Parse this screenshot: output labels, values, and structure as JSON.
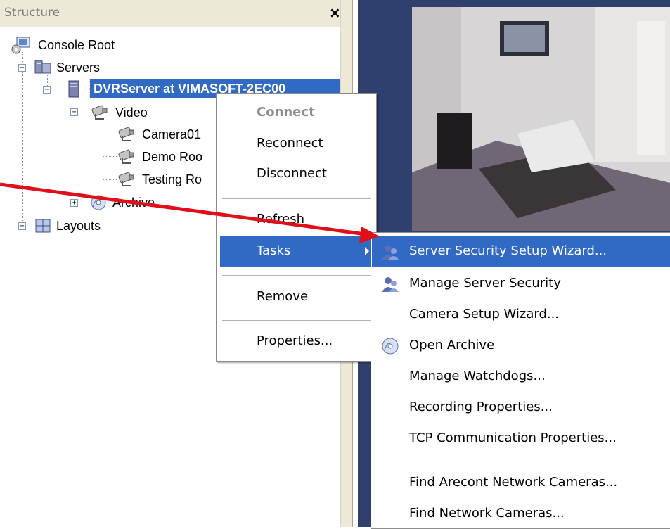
{
  "panel": {
    "title": "Structure",
    "close_glyph": "×"
  },
  "tree": {
    "console_root": "Console Root",
    "servers": "Servers",
    "selected_server": "DVRServer at VIMASOFT-2EC00",
    "video": "Video",
    "cameras": [
      "Camera01",
      "Demo Roo",
      "Testing Ro"
    ],
    "archive": "Archive",
    "layouts": "Layouts"
  },
  "context_menu": {
    "connect": "Connect",
    "reconnect": "Reconnect",
    "disconnect": "Disconnect",
    "refresh": "Refresh",
    "tasks": "Tasks",
    "remove": "Remove",
    "properties": "Properties..."
  },
  "tasks_submenu": {
    "items": [
      "Server Security Setup Wizard...",
      "Manage Server Security",
      "Camera Setup Wizard...",
      "Open Archive",
      "Manage Watchdogs...",
      "Recording Properties...",
      "TCP Communication Properties..."
    ],
    "items_after_separator": [
      "Find Arecont Network Cameras...",
      "Find Network Cameras..."
    ]
  },
  "icons": {
    "console_root": "console-root-icon",
    "servers": "servers-folder-icon",
    "server": "server-icon",
    "camera": "camera-icon",
    "archive": "archive-disc-icon",
    "layouts": "layouts-grid-icon",
    "security": "security-users-icon"
  },
  "colors": {
    "selection": "#316ac5",
    "annotation_arrow": "#e0101a",
    "viewport_bg": "#30406e"
  }
}
